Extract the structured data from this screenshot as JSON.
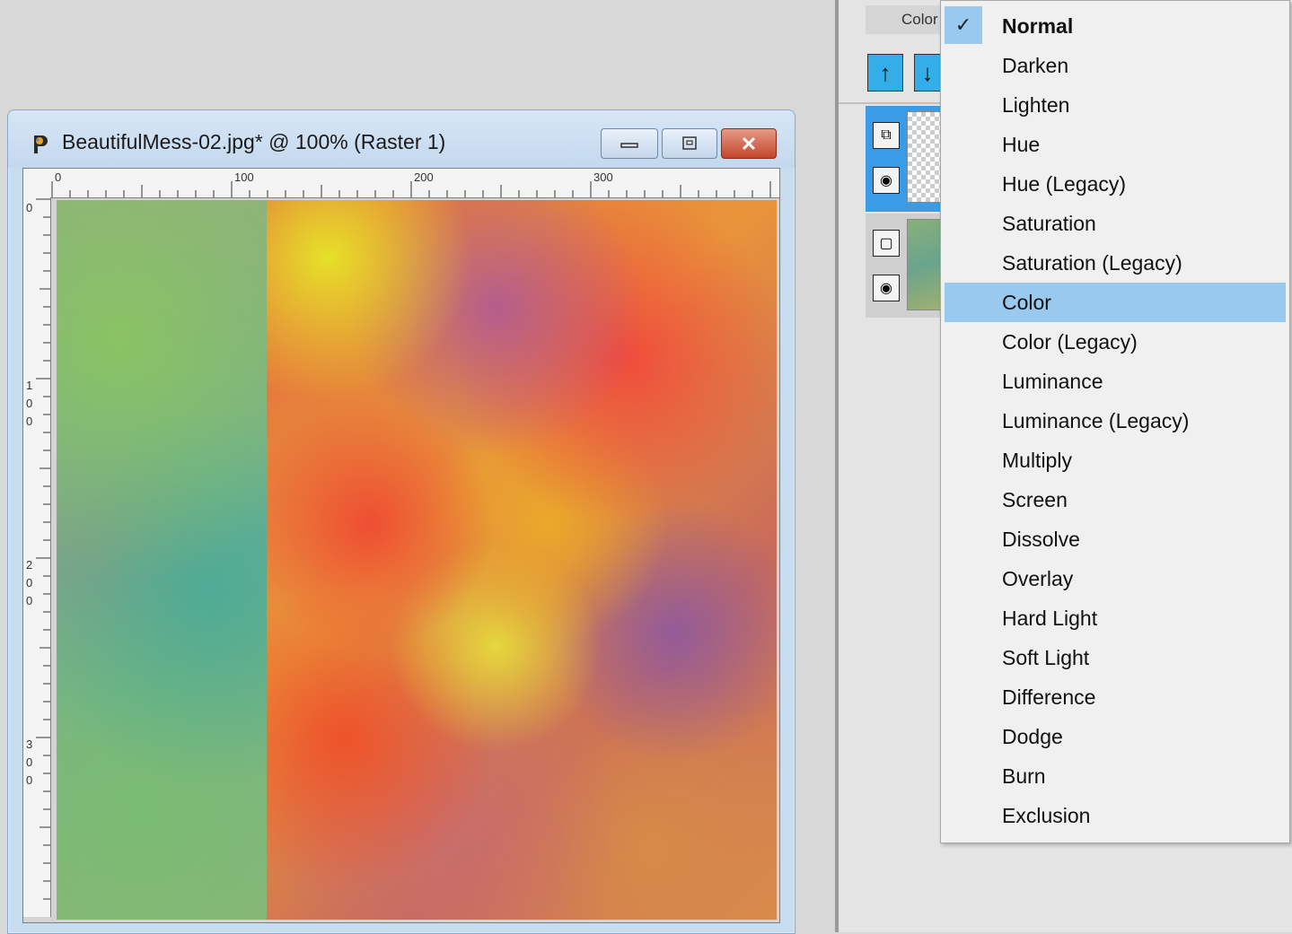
{
  "document": {
    "title": "BeautifulMess-02.jpg* @ 100% (Raster 1)",
    "ruler_top_labels": [
      "0",
      "100",
      "200",
      "300"
    ],
    "ruler_left_labels": [
      "0",
      "1\n0\n0",
      "2\n0\n0",
      "3\n0\n0"
    ]
  },
  "layers_panel": {
    "blend_label": "Color"
  },
  "blend_menu": {
    "checked_item": "Normal",
    "highlighted_item": "Color",
    "items": [
      "Normal",
      "Darken",
      "Lighten",
      "Hue",
      "Hue (Legacy)",
      "Saturation",
      "Saturation (Legacy)",
      "Color",
      "Color (Legacy)",
      "Luminance",
      "Luminance (Legacy)",
      "Multiply",
      "Screen",
      "Dissolve",
      "Overlay",
      "Hard Light",
      "Soft Light",
      "Difference",
      "Dodge",
      "Burn",
      "Exclusion"
    ]
  },
  "colors": {
    "menu_highlight": "#99c9ef",
    "layer_selected": "#3a9ce6",
    "close_button": "#c4452c"
  }
}
